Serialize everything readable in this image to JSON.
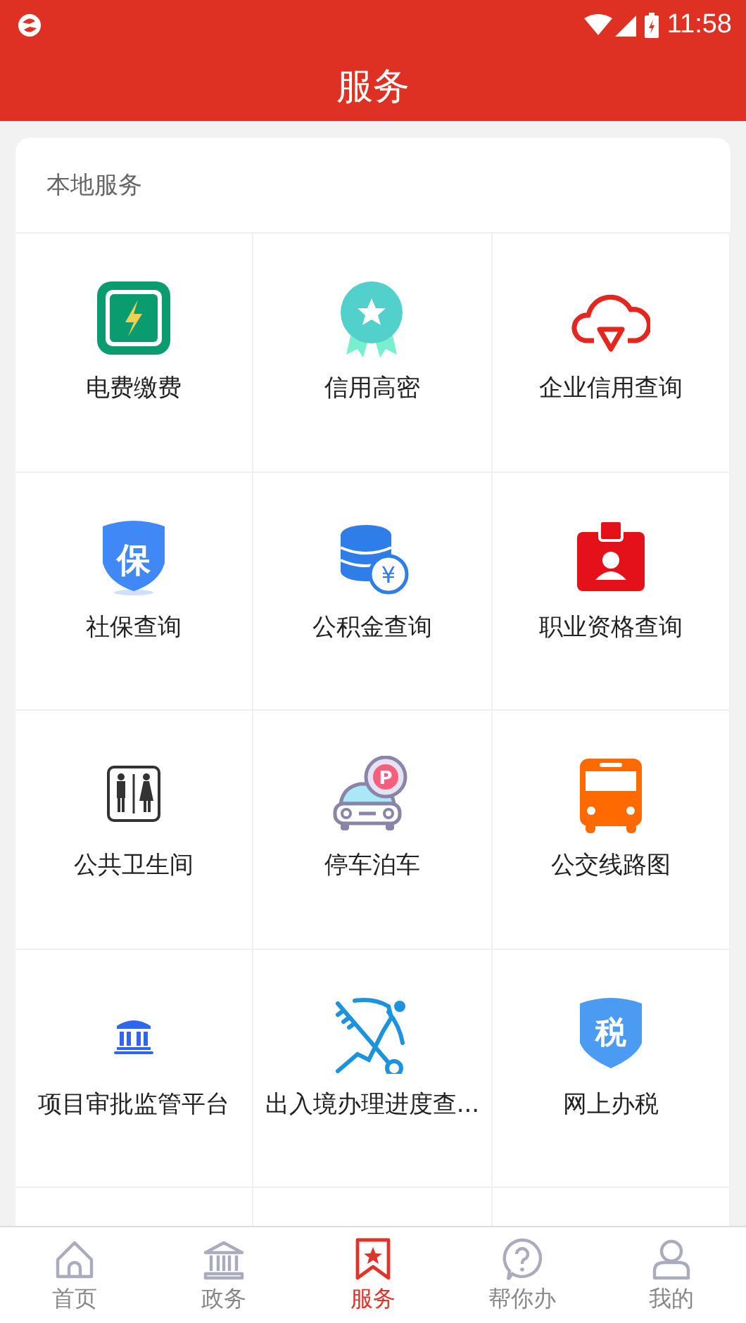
{
  "status_bar": {
    "time": "11:58"
  },
  "header": {
    "title": "服务"
  },
  "section": {
    "title": "本地服务",
    "items": [
      {
        "label": "电费缴费",
        "kind": "electricity"
      },
      {
        "label": "信用高密",
        "kind": "medal"
      },
      {
        "label": "企业信用查询",
        "kind": "cloud"
      },
      {
        "label": "社保查询",
        "kind": "shield",
        "glyph": "保"
      },
      {
        "label": "公积金查询",
        "kind": "coins",
        "glyph": "¥"
      },
      {
        "label": "职业资格查询",
        "kind": "badge"
      },
      {
        "label": "公共卫生间",
        "kind": "toilet"
      },
      {
        "label": "停车泊车",
        "kind": "parking",
        "glyph": "P"
      },
      {
        "label": "公交线路图",
        "kind": "bus"
      },
      {
        "label": "项目审批监管平台",
        "kind": "bank"
      },
      {
        "label": "出入境办理进度查...",
        "kind": "keys"
      },
      {
        "label": "网上办税",
        "kind": "tax",
        "glyph": "税"
      }
    ]
  },
  "tabs": [
    {
      "label": "首页",
      "kind": "home",
      "selected": false
    },
    {
      "label": "政务",
      "kind": "bank",
      "selected": false
    },
    {
      "label": "服务",
      "kind": "bookmark",
      "selected": true
    },
    {
      "label": "帮你办",
      "kind": "help",
      "selected": false
    },
    {
      "label": "我的",
      "kind": "person",
      "selected": false
    }
  ]
}
